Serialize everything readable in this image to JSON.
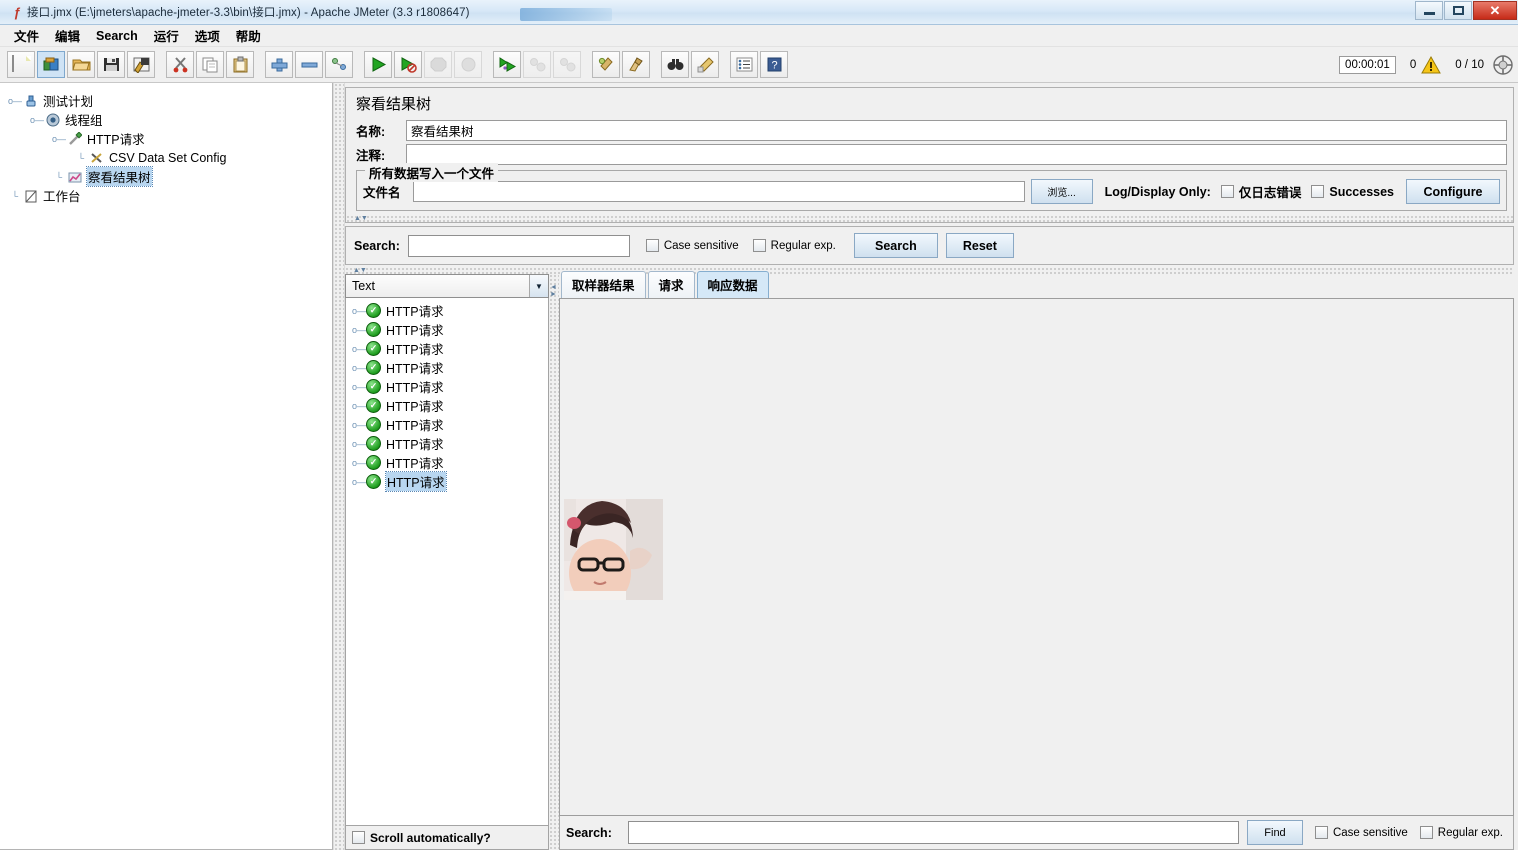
{
  "window": {
    "title": "接口.jmx (E:\\jmeters\\apache-jmeter-3.3\\bin\\接口.jmx) - Apache JMeter (3.3 r1808647)",
    "app_icon": "jmeter-icon",
    "minimize_label": "—",
    "maximize_label": "□",
    "close_label": "✕"
  },
  "menu": {
    "items": [
      {
        "label": "文件",
        "name": "menu-file"
      },
      {
        "label": "编辑",
        "name": "menu-edit"
      },
      {
        "label": "Search",
        "name": "menu-search"
      },
      {
        "label": "运行",
        "name": "menu-run"
      },
      {
        "label": "选项",
        "name": "menu-options"
      },
      {
        "label": "帮助",
        "name": "menu-help"
      }
    ]
  },
  "toolbar": {
    "buttons": [
      {
        "name": "new-button",
        "icon": "new-document-icon",
        "state": "normal"
      },
      {
        "name": "templates-button",
        "icon": "templates-icon",
        "state": "selected"
      },
      {
        "name": "open-button",
        "icon": "open-folder-icon",
        "state": "normal"
      },
      {
        "name": "save-button",
        "icon": "save-disk-icon",
        "state": "normal"
      },
      {
        "name": "save-as-button",
        "icon": "save-as-icon",
        "state": "normal"
      },
      {
        "name": "cut-button",
        "icon": "scissors-icon",
        "state": "normal"
      },
      {
        "name": "copy-button",
        "icon": "copy-icon",
        "state": "normal"
      },
      {
        "name": "paste-button",
        "icon": "clipboard-icon",
        "state": "normal"
      },
      {
        "name": "expand-all-button",
        "icon": "plus-icon",
        "state": "normal"
      },
      {
        "name": "collapse-all-button",
        "icon": "minus-icon",
        "state": "normal"
      },
      {
        "name": "toggle-button",
        "icon": "toggle-icon",
        "state": "normal"
      },
      {
        "name": "start-button",
        "icon": "start-green-triangle-icon",
        "state": "normal"
      },
      {
        "name": "start-no-pauses-button",
        "icon": "start-no-timers-icon",
        "state": "normal"
      },
      {
        "name": "stop-button",
        "icon": "stop-octagon-icon",
        "state": "disabled"
      },
      {
        "name": "shutdown-button",
        "icon": "shutdown-circle-icon",
        "state": "disabled"
      },
      {
        "name": "remote-start-all-button",
        "icon": "remote-start-icon",
        "state": "normal"
      },
      {
        "name": "remote-stop-all-button",
        "icon": "remote-stop-icon",
        "state": "disabled"
      },
      {
        "name": "remote-shutdown-all-button",
        "icon": "remote-shutdown-icon",
        "state": "disabled"
      },
      {
        "name": "clear-button",
        "icon": "clear-broom-icon",
        "state": "normal"
      },
      {
        "name": "clear-all-button",
        "icon": "clear-all-broom-icon",
        "state": "normal"
      },
      {
        "name": "search-button",
        "icon": "binoculars-icon",
        "state": "normal"
      },
      {
        "name": "search-reset-button",
        "icon": "reset-search-icon",
        "state": "normal"
      },
      {
        "name": "function-helper-button",
        "icon": "function-list-icon",
        "state": "normal"
      },
      {
        "name": "help-button",
        "icon": "help-book-icon",
        "state": "normal"
      }
    ],
    "status": {
      "timer": "00:00:01",
      "warning_count": "0",
      "warning_icon": "warning-triangle-icon",
      "threads": "0 / 10",
      "threads_icon": "thread-gauge-icon"
    }
  },
  "tree": {
    "nodes": [
      {
        "label": "测试计划",
        "icon": "test-plan-icon",
        "depth": 0,
        "handle": "expanded",
        "selected": false
      },
      {
        "label": "线程组",
        "icon": "thread-group-icon",
        "depth": 1,
        "handle": "expanded",
        "selected": false
      },
      {
        "label": "HTTP请求",
        "icon": "http-request-icon",
        "depth": 2,
        "handle": "expanded",
        "selected": false
      },
      {
        "label": "CSV Data Set Config",
        "icon": "csv-config-icon",
        "depth": 3,
        "handle": "leaf",
        "selected": false
      },
      {
        "label": "察看结果树",
        "icon": "results-tree-icon",
        "depth": 2,
        "handle": "leaf",
        "selected": true
      },
      {
        "label": "工作台",
        "icon": "workbench-icon",
        "depth": 0,
        "handle": "leaf",
        "selected": false
      }
    ]
  },
  "panel": {
    "title": "察看结果树",
    "name_label": "名称:",
    "name_value": "察看结果树",
    "comment_label": "注释:",
    "comment_value": "",
    "comment_placeholder": ""
  },
  "file_group": {
    "title": "所有数据写入一个文件",
    "filename_label": "文件名",
    "filename_value": "",
    "browse_label": "浏览...",
    "log_display_label": "Log/Display Only:",
    "errors_only_label": "仅日志错误",
    "errors_only_checked": false,
    "successes_label": "Successes",
    "successes_checked": false,
    "configure_label": "Configure"
  },
  "search_panel": {
    "label": "Search:",
    "value": "",
    "case_sensitive_label": "Case sensitive",
    "case_sensitive_checked": false,
    "regular_exp_label": "Regular exp.",
    "regular_exp_checked": false,
    "search_button": "Search",
    "reset_button": "Reset"
  },
  "results": {
    "render_selector": "Text",
    "render_selector_options": [
      "Text"
    ],
    "items": [
      {
        "label": "HTTP请求",
        "status": "success",
        "selected": false
      },
      {
        "label": "HTTP请求",
        "status": "success",
        "selected": false
      },
      {
        "label": "HTTP请求",
        "status": "success",
        "selected": false
      },
      {
        "label": "HTTP请求",
        "status": "success",
        "selected": false
      },
      {
        "label": "HTTP请求",
        "status": "success",
        "selected": false
      },
      {
        "label": "HTTP请求",
        "status": "success",
        "selected": false
      },
      {
        "label": "HTTP请求",
        "status": "success",
        "selected": false
      },
      {
        "label": "HTTP请求",
        "status": "success",
        "selected": false
      },
      {
        "label": "HTTP请求",
        "status": "success",
        "selected": false
      },
      {
        "label": "HTTP请求",
        "status": "success",
        "selected": true
      }
    ],
    "scroll_auto_label": "Scroll automatically?",
    "scroll_auto_checked": false
  },
  "tabs": [
    {
      "label": "取样器结果",
      "name": "tab-sampler-result",
      "active": false
    },
    {
      "label": "请求",
      "name": "tab-request",
      "active": false
    },
    {
      "label": "响应数据",
      "name": "tab-response-data",
      "active": true
    }
  ],
  "response": {
    "content_type": "image",
    "image_description": "person-photo"
  },
  "bottom_search": {
    "label": "Search:",
    "value": "",
    "find_button": "Find",
    "case_sensitive_label": "Case sensitive",
    "case_sensitive_checked": false,
    "regular_exp_label": "Regular exp.",
    "regular_exp_checked": false
  },
  "colors": {
    "window_bg": "#f0f0f0",
    "titlebar": "#cfe2f3",
    "accent_blue": "#b8d6f0",
    "active_tab": "#d5e8f7",
    "success_green": "#1f9e1f",
    "close_red": "#c62b18",
    "warning_yellow": "#f5c518"
  }
}
